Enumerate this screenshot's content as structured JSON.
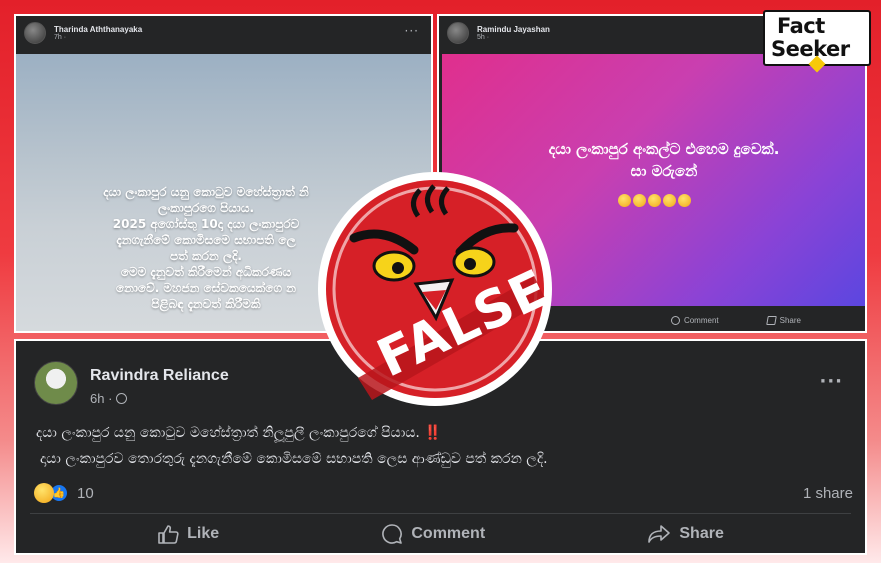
{
  "colors": {
    "background_red": "#e3202a",
    "facebook_dark": "#242526",
    "text_primary": "#e4e6eb",
    "text_secondary": "#b0b3b8",
    "stamp_red": "#d62027",
    "like_blue": "#1877f2"
  },
  "logo": {
    "line1": "Fact",
    "line2": "Seeker"
  },
  "stamp": {
    "label": "FALSE"
  },
  "post_top_left": {
    "author": "Tharinda Aththanayaka",
    "time": "7h · ",
    "more_icon": "more-dots-icon",
    "text_lines": [
      "දයා ලංකාපුර යනු කොටුව මහේස්ත්‍රාත් නි",
      "ලංකාපුරගෙ පියාය.",
      "2025 අගෝස්තු 10දා දයා ලංකාපුරව",
      "දැනගැනීමේ කොමිසමෙ සභාපති ලෙ",
      "පත් කරන ලදි.",
      "මෙම දැනුවත් කිරීමෙන් අධිකරණය",
      "නොවේ. මහජන සේවකයෙක්ගෙ න",
      "පිළිබඳ දැනවත් කිරීමකි"
    ]
  },
  "post_top_right": {
    "author": "Ramindu Jayashan",
    "time": "5h · ",
    "text_line1": "දයා ලංකාපුර අංකල්ට එහෙම දුවෙක්.",
    "text_line2": "සා මරුනේ",
    "emoji_icons": [
      "grin-icon",
      "grin-icon",
      "grin-icon",
      "grin-icon",
      "grin-icon"
    ],
    "comment_label": "Comment",
    "share_label": "Share"
  },
  "post_bottom": {
    "author": "Ravindra Reliance",
    "time": "6h · ",
    "line1": "දයා ලංකාපුර යනු කොටුව මහේස්ත්‍රාත් නිලූපුලී ලංකාපුරගේ පියාය. ",
    "line1_emoji": "‼️",
    "line2": "දායා ලංකාපුරව තොරතුරු දැනගැනීමේ කොමිසමේ සභාපති ලෙස ආණ්ඩුව පත් කරන ලදි.",
    "reaction_count": "10",
    "shares": "1 share",
    "like_label": "Like",
    "comment_label": "Comment",
    "share_label": "Share"
  }
}
